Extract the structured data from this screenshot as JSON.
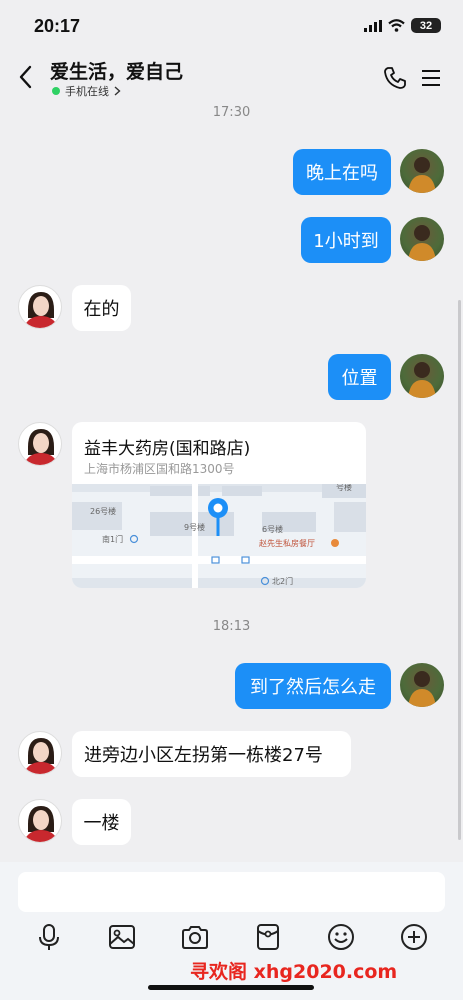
{
  "status_bar": {
    "time": "20:17",
    "battery": "32"
  },
  "header": {
    "title": "爱生活，爱自己",
    "online_status": "手机在线"
  },
  "messages": [
    {
      "type": "time",
      "text": "17:30"
    },
    {
      "type": "out",
      "text": "晚上在吗"
    },
    {
      "type": "out",
      "text": "1小时到"
    },
    {
      "type": "in",
      "text": "在的"
    },
    {
      "type": "out",
      "text": "位置"
    },
    {
      "type": "location",
      "name": "益丰大药房(国和路店)",
      "address": "上海市杨浦区国和路1300号",
      "map_labels": {
        "bld_26": "26号楼",
        "bld_9": "9号楼",
        "bld_6": "6号楼",
        "south_gate": "南1门",
        "north_gate": "北2门",
        "restaurant": "赵先生私房餐厅",
        "top": "号楼"
      }
    },
    {
      "type": "time",
      "text": "18:13"
    },
    {
      "type": "out",
      "text": "到了然后怎么走"
    },
    {
      "type": "in",
      "text": "进旁边小区左拐第一栋楼27号"
    },
    {
      "type": "in",
      "text": "一楼"
    }
  ],
  "input": {
    "placeholder": ""
  },
  "toolbar": [
    "mic-icon",
    "image-icon",
    "camera-icon",
    "red-packet-icon",
    "emoji-icon",
    "plus-icon"
  ],
  "watermark": "寻欢阁 xhg2020.com",
  "colors": {
    "bubble_out": "#1c8ff7",
    "background": "#efeff1",
    "online": "#2fd164",
    "watermark": "#e8261f"
  }
}
